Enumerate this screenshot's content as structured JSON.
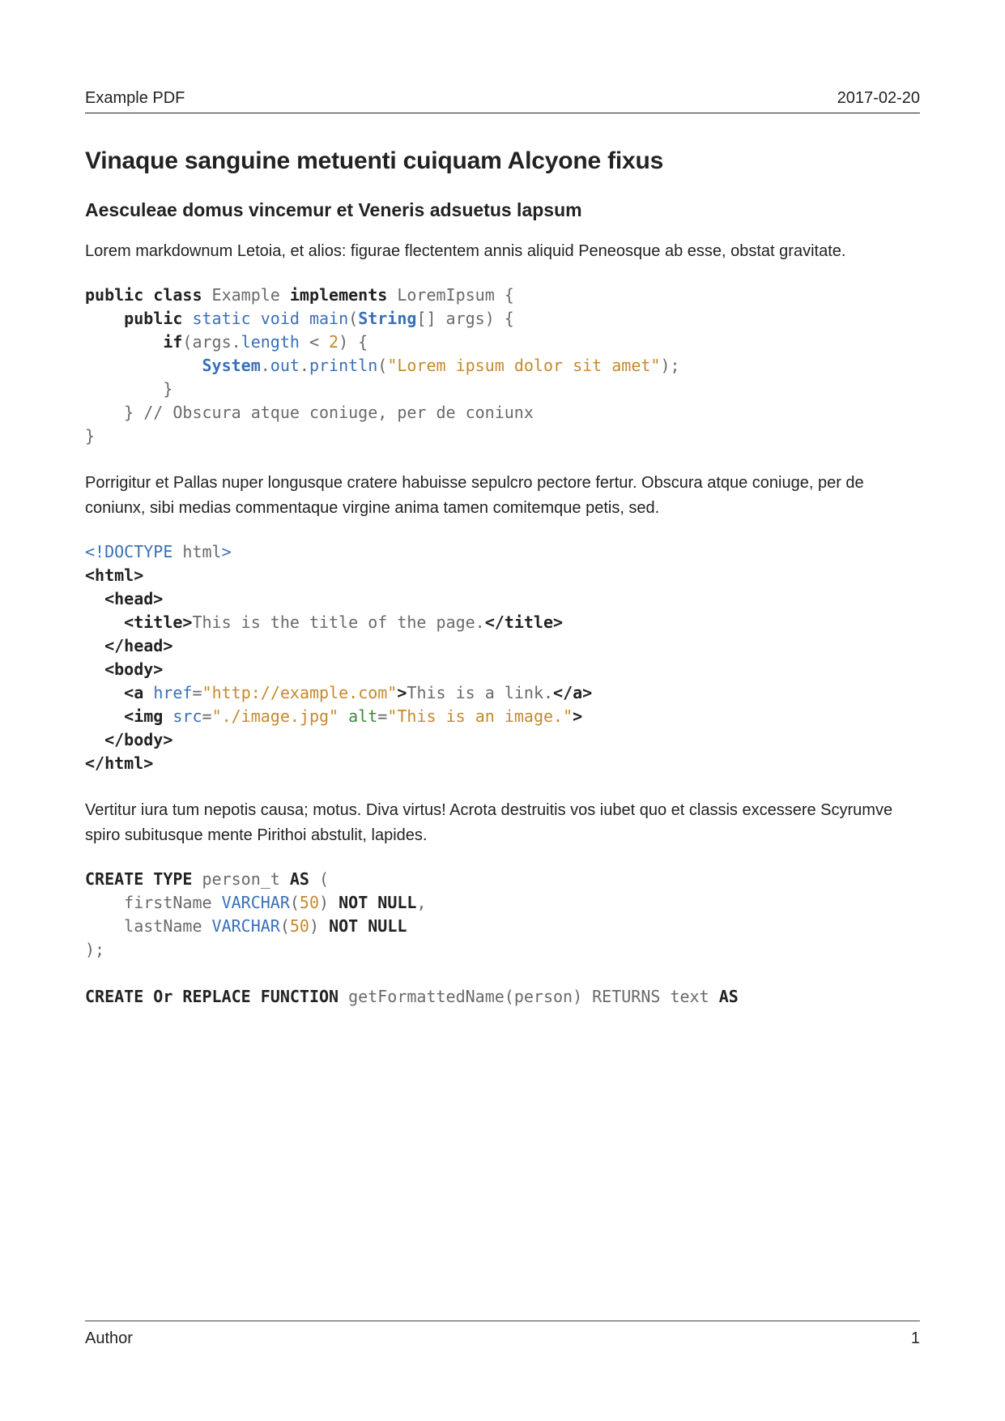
{
  "header": {
    "left": "Example PDF",
    "right": "2017-02-20"
  },
  "h1": "Vinaque sanguine metuenti cuiquam Alcyone fixus",
  "h2": "Aesculeae domus vincemur et Veneris adsuetus lapsum",
  "p1": "Lorem markdownum Letoia, et alios: figurae flectentem annis aliquid Peneosque ab esse, obstat gravitate.",
  "code_java": {
    "l1a": "public class",
    "l1b": " Example ",
    "l1c": "implements",
    "l1d": " LoremIpsum {",
    "l2a": "    ",
    "l2b": "public",
    "l2c": " ",
    "l2d": "static void",
    "l2e": " ",
    "l2f": "main",
    "l2g": "(",
    "l2h": "String",
    "l2i": "[] args) {",
    "l3a": "        ",
    "l3b": "if",
    "l3c": "(args.",
    "l3d": "length",
    "l3e": " < ",
    "l3f": "2",
    "l3g": ") {",
    "l4a": "            ",
    "l4b": "System",
    "l4c": ".",
    "l4d": "out",
    "l4e": ".",
    "l4f": "println",
    "l4g": "(",
    "l4h": "\"Lorem ipsum dolor sit amet\"",
    "l4i": ");",
    "l5": "        }",
    "l6a": "    } ",
    "l6b": "// Obscura atque coniuge, per de coniunx",
    "l7": "}"
  },
  "p2": "Porrigitur et Pallas nuper longusque cratere habuisse sepulcro pectore fertur. Obscura atque coniuge, per de coniunx, sibi medias commentaque virgine anima tamen comitemque petis, sed.",
  "code_html": {
    "l1a": "<!DOCTYPE",
    "l1b": " html",
    "l1c": ">",
    "l2": "<html>",
    "l3a": "  ",
    "l3b": "<head>",
    "l4a": "    ",
    "l4b": "<title>",
    "l4c": "This is the title of the page.",
    "l4d": "</title>",
    "l5a": "  ",
    "l5b": "</head>",
    "l6a": "  ",
    "l6b": "<body>",
    "l7a": "    ",
    "l7b": "<a",
    "l7c": " ",
    "l7d": "href",
    "l7e": "=",
    "l7f": "\"http://example.com\"",
    "l7g": ">",
    "l7h": "This is a link.",
    "l7i": "</a>",
    "l8a": "    ",
    "l8b": "<img",
    "l8c": " ",
    "l8d": "src",
    "l8e": "=",
    "l8f": "\"./image.jpg\"",
    "l8g": " ",
    "l8h": "alt",
    "l8i": "=",
    "l8j": "\"This is an image.\"",
    "l8k": ">",
    "l9a": "  ",
    "l9b": "</body>",
    "l10": "</html>"
  },
  "p3": "Vertitur iura tum nepotis causa; motus. Diva virtus! Acrota destruitis vos iubet quo et classis excessere Scyrumve spiro subitusque mente Pirithoi abstulit, lapides.",
  "code_sql": {
    "l1a": "CREATE TYPE",
    "l1b": " person_t ",
    "l1c": "AS",
    "l1d": " (",
    "l2a": "    firstName ",
    "l2b": "VARCHAR",
    "l2c": "(",
    "l2d": "50",
    "l2e": ") ",
    "l2f": "NOT NULL",
    "l2g": ",",
    "l3a": "    lastName ",
    "l3b": "VARCHAR",
    "l3c": "(",
    "l3d": "50",
    "l3e": ") ",
    "l3f": "NOT NULL",
    "l4": ");",
    "gap": "",
    "l5a": "CREATE Or REPLACE FUNCTION",
    "l5b": " getFormattedName(person) RETURNS text ",
    "l5c": "AS"
  },
  "footer": {
    "left": "Author",
    "right": "1"
  }
}
